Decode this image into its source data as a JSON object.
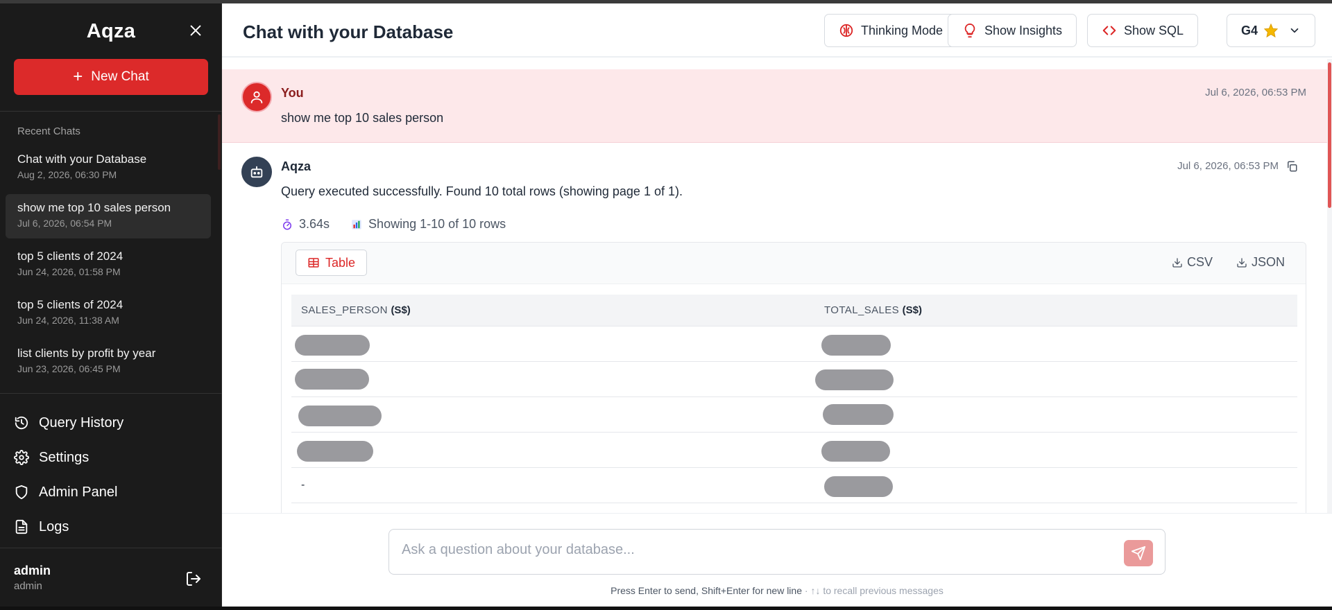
{
  "sidebar": {
    "brand": "Aqza",
    "new_chat_label": "New Chat",
    "recent_title": "Recent Chats",
    "chats": [
      {
        "title": "Chat with your Database",
        "date": "Aug 2, 2026, 06:30 PM"
      },
      {
        "title": "show me top 10 sales person",
        "date": "Jul 6, 2026, 06:54 PM"
      },
      {
        "title": "top 5 clients of 2024",
        "date": "Jun 24, 2026, 01:58 PM"
      },
      {
        "title": "top 5 clients of 2024",
        "date": "Jun 24, 2026, 11:38 AM"
      },
      {
        "title": "list clients by profit by year",
        "date": "Jun 23, 2026, 06:45 PM"
      }
    ],
    "nav": [
      {
        "label": "Query History",
        "icon": "history-icon"
      },
      {
        "label": "Settings",
        "icon": "gear-icon"
      },
      {
        "label": "Admin Panel",
        "icon": "shield-icon"
      },
      {
        "label": "Logs",
        "icon": "document-icon"
      }
    ],
    "user": {
      "name": "admin",
      "role": "admin"
    }
  },
  "header": {
    "title": "Chat with your Database",
    "thinking_label": "Thinking Mode",
    "insights_label": "Show Insights",
    "sql_label": "Show SQL",
    "model_label": "G4"
  },
  "messages": {
    "user": {
      "sender": "You",
      "timestamp": "Jul 6, 2026, 06:53 PM",
      "text": "show me top 10 sales person"
    },
    "bot": {
      "sender": "Aqza",
      "timestamp": "Jul 6, 2026, 06:53 PM",
      "text": "Query executed successfully. Found 10 total rows (showing page 1 of 1).",
      "duration": "3.64s",
      "rows_info": "Showing 1-10 of 10 rows"
    }
  },
  "result": {
    "tab_label": "Table",
    "csv_label": "CSV",
    "json_label": "JSON",
    "columns": [
      {
        "name": "SALES_PERSON",
        "unit": "(S$)"
      },
      {
        "name": "TOTAL_SALES",
        "unit": "(S$)"
      }
    ],
    "last_row_value": "-"
  },
  "composer": {
    "placeholder": "Ask a question about your database...",
    "hint": "Press Enter to send, Shift+Enter for new line",
    "hint_sub": "· ↑↓ to recall previous messages"
  },
  "colors": {
    "accent": "#dc2a2a",
    "sidebar_bg": "#1b1b1b",
    "user_msg_bg": "#fde8ea"
  }
}
